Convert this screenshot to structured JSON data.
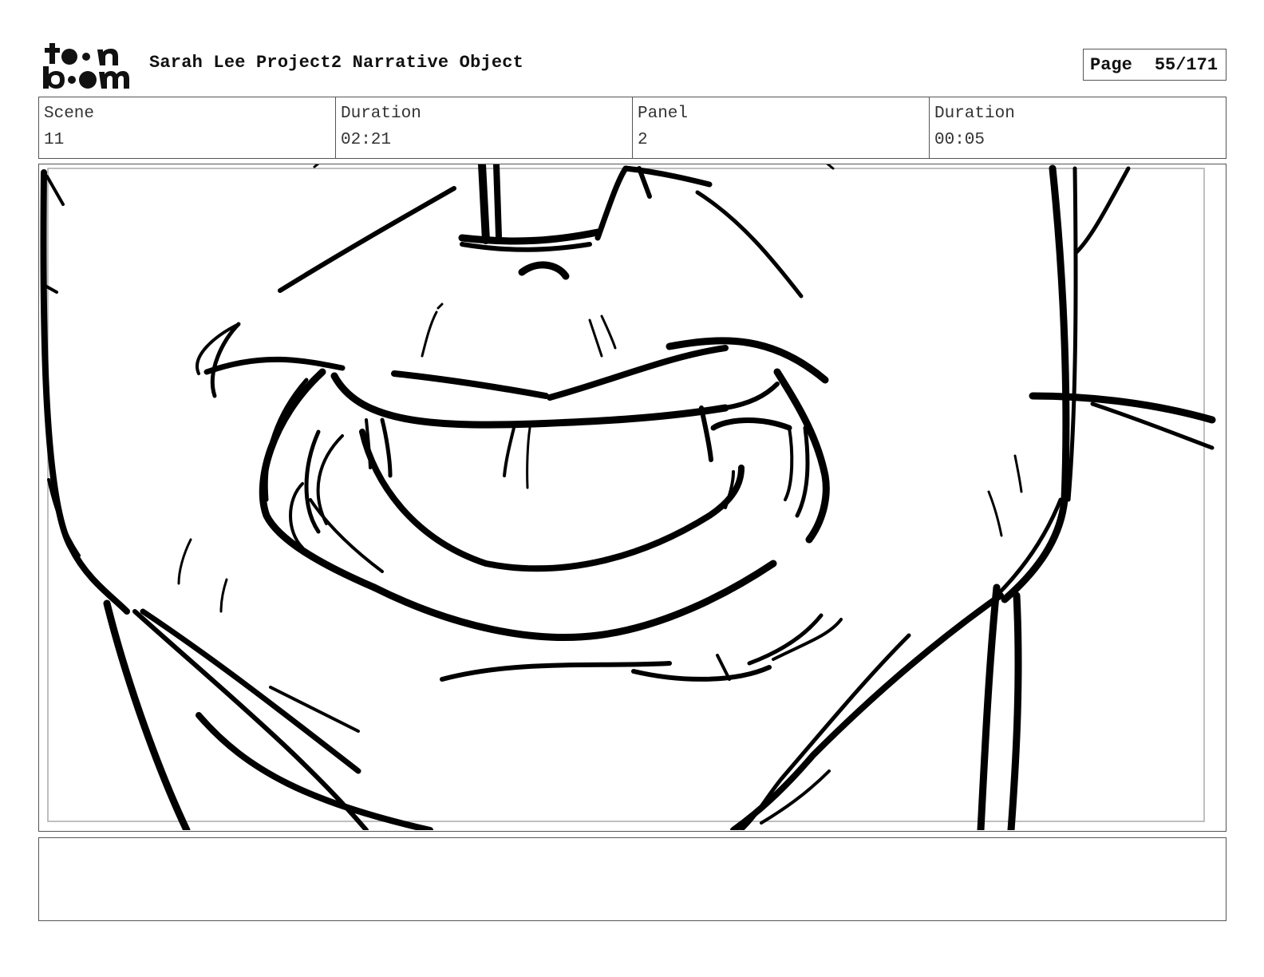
{
  "header": {
    "logo_text": "toon boom",
    "project_title": "Sarah Lee Project2 Narrative Object",
    "page_label": "Page",
    "page_value": "55/171"
  },
  "info": {
    "scene_label": "Scene",
    "scene_value": "11",
    "scene_duration_label": "Duration",
    "scene_duration_value": "02:21",
    "panel_label": "Panel",
    "panel_value": "2",
    "panel_duration_label": "Duration",
    "panel_duration_value": "00:05"
  },
  "panel_image": {
    "description_icon": "sketch-closeup-grin-icon"
  },
  "notes": {
    "text": ""
  }
}
